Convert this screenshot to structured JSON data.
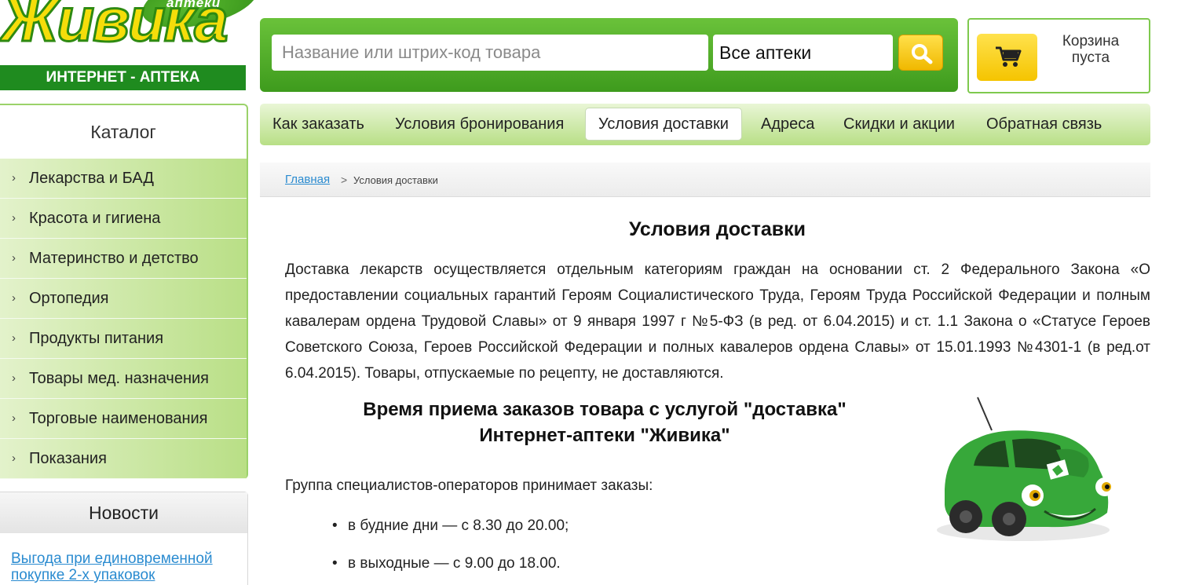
{
  "logo": {
    "word": "Живика",
    "leaf_text": "аптеки",
    "strip_text": "ИНТЕРНЕТ - АПТЕКА"
  },
  "search": {
    "placeholder": "Название или штрих-код товара",
    "store_selected": "Все аптеки",
    "button_icon": "search-icon"
  },
  "cart": {
    "icon": "cart-icon",
    "line1": "Корзина",
    "line2": "пуста"
  },
  "topnav": {
    "items": [
      {
        "label": "Как заказать",
        "active": false
      },
      {
        "label": "Условия бронирования",
        "active": false
      },
      {
        "label": "Условия доставки",
        "active": true
      },
      {
        "label": "Адреса",
        "active": false
      },
      {
        "label": "Скидки и акции",
        "active": false
      },
      {
        "label": "Обратная связь",
        "active": false
      }
    ]
  },
  "catalog": {
    "title": "Каталог",
    "items": [
      {
        "label": "Лекарства и БАД"
      },
      {
        "label": "Красота и гигиена"
      },
      {
        "label": "Материнство и детство"
      },
      {
        "label": "Ортопедия"
      },
      {
        "label": "Продукты питания"
      },
      {
        "label": "Товары мед. назначения"
      },
      {
        "label": "Торговые наименования"
      },
      {
        "label": "Показания"
      }
    ]
  },
  "news": {
    "title": "Новости",
    "link": "Выгода при единовременной покупке 2-х упаковок"
  },
  "breadcrumb": {
    "home": "Главная",
    "separator": ">",
    "current": "Условия доставки"
  },
  "content": {
    "title": "Условия доставки",
    "intro": "Доставка лекарств осуществляется отдельным категориям граждан на основании ст. 2 Федерального Закона «О предоставлении социальных гарантий Героям Социалистического Труда, Героям Труда Российской Федерации и полным кавалерам ордена Трудовой Славы» от 9 января 1997 г №5-ФЗ (в ред. от 6.04.2015) и ст. 1.1 Закона о «Статусе Героев Советского Союза, Героев Российской Федерации и полных кавалеров ордена Славы» от 15.01.1993 №4301-1 (в ред.от 6.04.2015). Товары, отпускаемые по рецепту, не доставляются.",
    "subtitle_line1": "Время приема заказов товара с услугой \"доставка\"",
    "subtitle_line2": "Интернет-аптеки \"Живика\"",
    "group_text": "Группа специалистов-операторов принимает заказы:",
    "schedule": [
      "в будние дни — с 8.30 до 20.00;",
      "в  выходные  — с 9.00 до 18.00."
    ],
    "bullet_symbol": "•"
  },
  "colors": {
    "brand_green": "#3e9b1d",
    "brand_yellow": "#f5dd0a",
    "link_blue": "#2a8bd0"
  }
}
